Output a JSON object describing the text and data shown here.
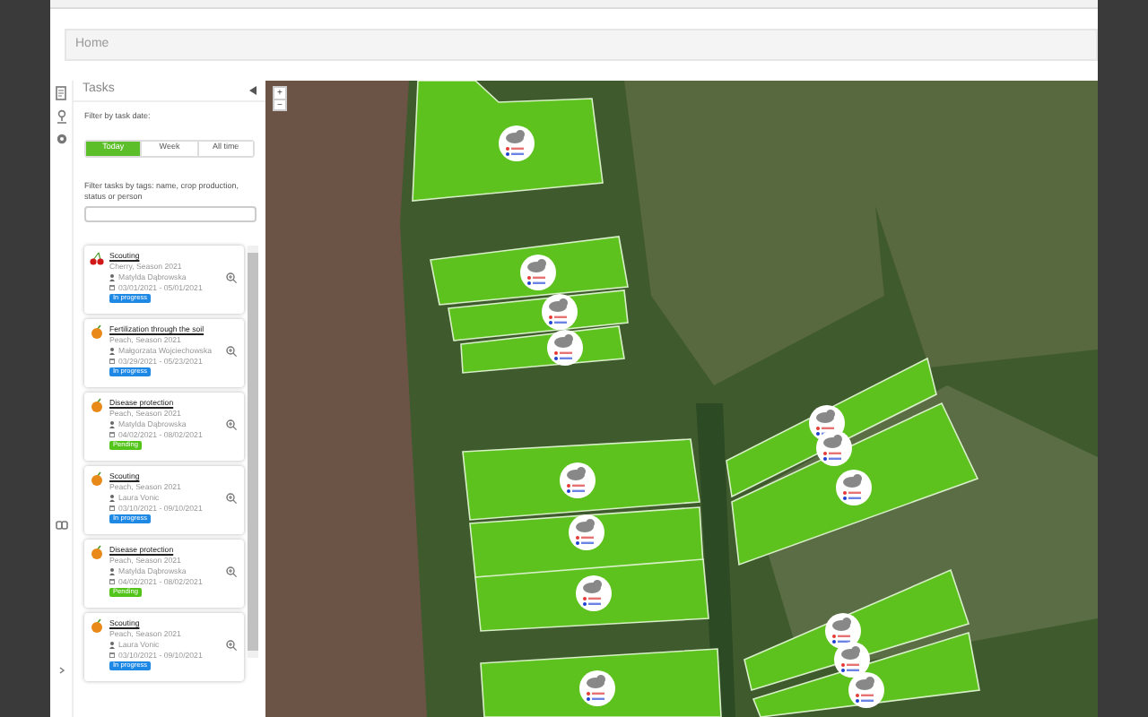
{
  "breadcrumb": "Home",
  "tasks_panel": {
    "title": "Tasks",
    "filter_date_label": "Filter by task date:",
    "date_filters": [
      {
        "label": "Today",
        "selected": true
      },
      {
        "label": "Week",
        "selected": false
      },
      {
        "label": "All time",
        "selected": false
      }
    ],
    "tag_filter_label": "Filter tasks by tags: name, crop production, status or person",
    "tasks": [
      {
        "kind": "cherry",
        "title": "Scouting",
        "crop": "Cherry, Season 2021",
        "person": "Matylda Dąbrowska",
        "dates": "03/01/2021 - 05/01/2021",
        "status": "In progress",
        "color": "#1e88e5"
      },
      {
        "kind": "peach",
        "title": "Fertilization through the soil",
        "crop": "Peach, Season 2021",
        "person": "Małgorzata Wojciechowska",
        "dates": "03/29/2021 - 05/23/2021",
        "status": "In progress",
        "color": "#1e88e5"
      },
      {
        "kind": "peach",
        "title": "Disease protection",
        "crop": "Peach, Season 2021",
        "person": "Matylda Dąbrowska",
        "dates": "04/02/2021 - 08/02/2021",
        "status": "Pending",
        "color": "#52c41a"
      },
      {
        "kind": "peach",
        "title": "Scouting",
        "crop": "Peach, Season 2021",
        "person": "Laura Vonic",
        "dates": "03/10/2021 - 09/10/2021",
        "status": "In progress",
        "color": "#1e88e5"
      },
      {
        "kind": "peach",
        "title": "Disease protection",
        "crop": "Peach, Season 2021",
        "person": "Matylda Dąbrowska",
        "dates": "04/02/2021 - 08/02/2021",
        "status": "Pending",
        "color": "#52c41a"
      },
      {
        "kind": "peach",
        "title": "Scouting",
        "crop": "Peach, Season 2021",
        "person": "Laura Vonic",
        "dates": "03/10/2021 - 09/10/2021",
        "status": "In progress",
        "color": "#1e88e5"
      }
    ]
  },
  "map": {
    "zoom_controls": [
      "+",
      "−"
    ]
  }
}
